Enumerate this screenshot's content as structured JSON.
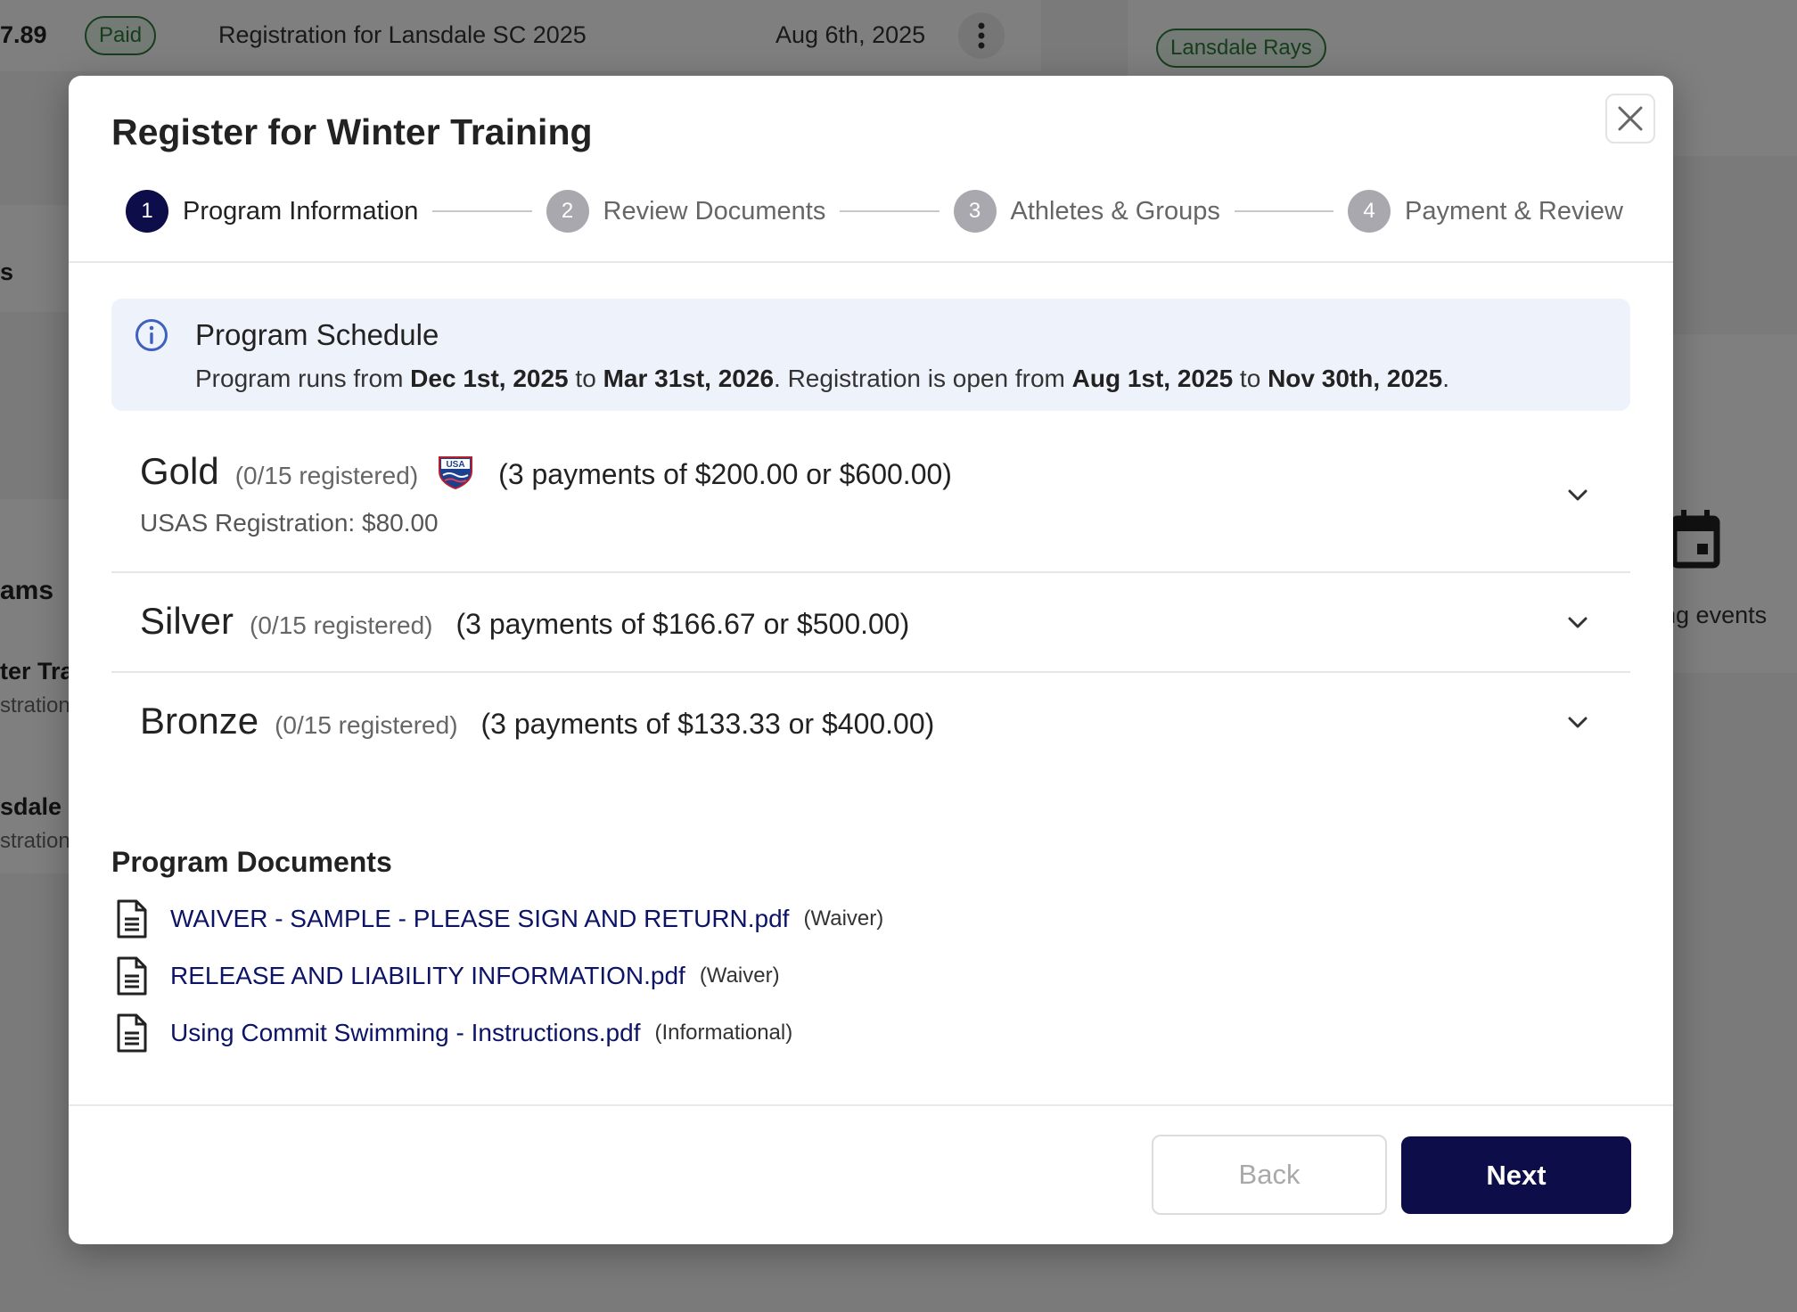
{
  "background": {
    "row_amount": "7.89",
    "row_status": "Paid",
    "row_description": "Registration for Lansdale SC 2025",
    "row_date": "Aug 6th, 2025",
    "team_badge": "Lansdale Rays",
    "left_fragment_1": "s",
    "left_heading": "ams",
    "left_item_1_title": "ter Tra",
    "left_item_1_sub": "stration",
    "left_item_2_title": "sdale",
    "left_item_2_sub": "stration",
    "right_events_text": "ning events"
  },
  "modal": {
    "title": "Register for Winter Training",
    "steps": [
      {
        "num": "1",
        "label": "Program Information"
      },
      {
        "num": "2",
        "label": "Review Documents"
      },
      {
        "num": "3",
        "label": "Athletes & Groups"
      },
      {
        "num": "4",
        "label": "Payment & Review"
      }
    ],
    "schedule": {
      "title": "Program Schedule",
      "t1": "Program runs from ",
      "program_start": "Dec 1st, 2025",
      "t2": " to ",
      "program_end": "Mar 31st, 2026",
      "t3": ". Registration is open from ",
      "reg_start": "Aug 1st, 2025",
      "t4": " to ",
      "reg_end": "Nov 30th, 2025",
      "t5": "."
    },
    "tiers": [
      {
        "name": "Gold",
        "count": "(0/15 registered)",
        "price": "(3 payments of $200.00 or $600.00)",
        "usas": "USAS Registration: $80.00"
      },
      {
        "name": "Silver",
        "count": "(0/15 registered)",
        "price": "(3 payments of $166.67 or $500.00)"
      },
      {
        "name": "Bronze",
        "count": "(0/15 registered)",
        "price": "(3 payments of $133.33 or $400.00)"
      }
    ],
    "usa_logo_text": "USA",
    "documents_title": "Program Documents",
    "documents": [
      {
        "name": "WAIVER - SAMPLE - PLEASE SIGN AND RETURN.pdf",
        "type": "(Waiver)"
      },
      {
        "name": "RELEASE AND LIABILITY INFORMATION.pdf",
        "type": "(Waiver)"
      },
      {
        "name": "Using Commit Swimming - Instructions.pdf",
        "type": "(Informational)"
      }
    ],
    "back_label": "Back",
    "next_label": "Next"
  },
  "colors": {
    "primary": "#0d0d4a",
    "link": "#0d1466",
    "paid_badge": "#2f7a3a",
    "info_bg": "#eef2fa"
  }
}
